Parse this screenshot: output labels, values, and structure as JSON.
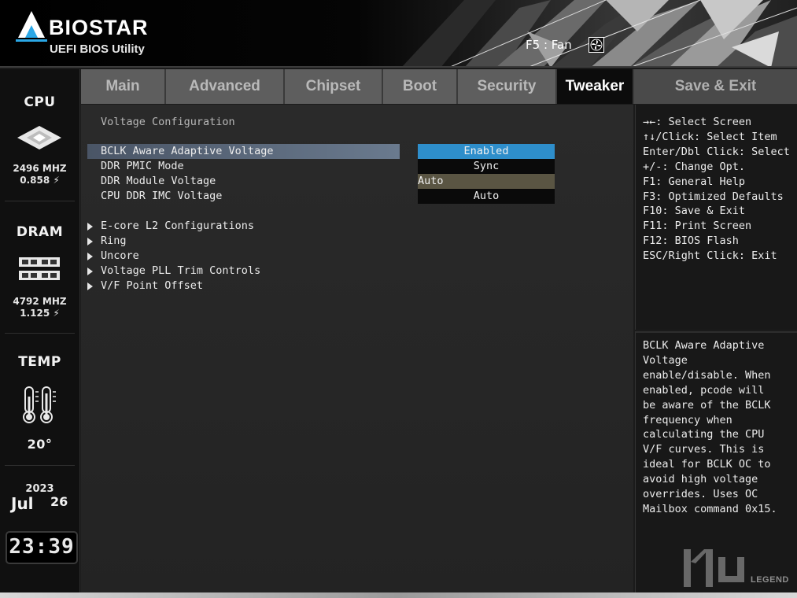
{
  "header": {
    "brand": "BIOSTAR",
    "subtitle": "UEFI BIOS Utility",
    "fan_hint": "F5 : Fan"
  },
  "status": {
    "cpu_label": "CPU",
    "cpu_freq": "2496 MHZ",
    "cpu_volt": "0.858 ⚡",
    "dram_label": "DRAM",
    "dram_freq": "4792 MHZ",
    "dram_volt": "1.125 ⚡",
    "temp_label": "TEMP",
    "temp_value": "20°",
    "year": "2023",
    "month": "Jul",
    "day": "26",
    "time": "23:39"
  },
  "tabs": [
    {
      "label": "Main"
    },
    {
      "label": "Advanced"
    },
    {
      "label": "Chipset"
    },
    {
      "label": "Boot"
    },
    {
      "label": "Security"
    },
    {
      "label": "Tweaker"
    },
    {
      "label": "Save & Exit"
    }
  ],
  "active_tab": "Tweaker",
  "main": {
    "section_title": "Voltage Configuration",
    "options": [
      {
        "label": "BCLK Aware Adaptive Voltage",
        "value": "Enabled"
      },
      {
        "label": "DDR PMIC Mode",
        "value": "Sync"
      },
      {
        "label": "DDR Module Voltage",
        "value": "Auto"
      },
      {
        "label": "CPU DDR IMC Voltage",
        "value": "Auto"
      }
    ],
    "submenus": [
      {
        "label": "E-core L2 Configurations"
      },
      {
        "label": "Ring"
      },
      {
        "label": "Uncore"
      },
      {
        "label": "Voltage PLL Trim Controls"
      },
      {
        "label": "V/F Point Offset"
      }
    ]
  },
  "keys": [
    "→←: Select Screen",
    "↑↓/Click: Select Item",
    "Enter/Dbl Click: Select",
    "+/-: Change Opt.",
    "F1: General Help",
    "F3: Optimized Defaults",
    "F10: Save & Exit",
    "F11: Print Screen",
    "F12: BIOS Flash",
    "ESC/Right Click: Exit"
  ],
  "help_lines": [
    "BCLK Aware Adaptive",
    "Voltage",
    "enable/disable. When",
    "enabled, pcode will",
    "be aware of the BCLK",
    "frequency when",
    "calculating the CPU",
    "V/F curves. This is",
    "ideal for BCLK OC to",
    "avoid high voltage",
    "overrides. Uses OC",
    "Mailbox command 0x15."
  ],
  "watermark": "LEGEND",
  "colors": {
    "accent": "#2e8ecb",
    "selected_row": "#5a6a7e",
    "tab_active": "#0c0c0c",
    "tab_inactive": "#5e5e5e"
  }
}
